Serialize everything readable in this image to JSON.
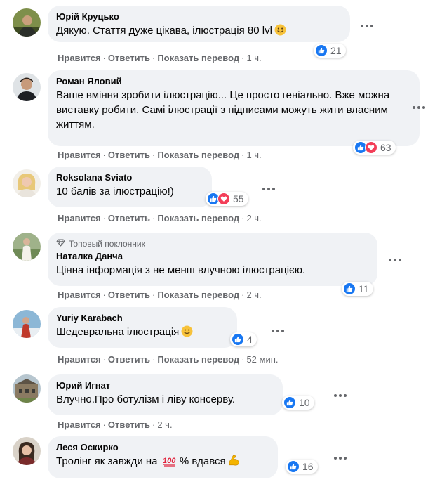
{
  "comments": [
    {
      "author": "Юрій Круцько",
      "text": "Дякую. Стаття дуже цікава, ілюстрація 80 lvl",
      "emoji": "slightly-smiling-face",
      "reactions": {
        "icons": [
          "like"
        ],
        "count": "21"
      },
      "actions": {
        "like": "Нравится",
        "reply": "Ответить",
        "translate": "Показать перевод",
        "time": "1 ч."
      }
    },
    {
      "author": "Роман Яловий",
      "text": "Ваше вміння зробити ілюстрацію... Це просто геніально. Вже можна виставку робити. Самі ілюстрації з підписами можуть жити власним життям.",
      "reactions": {
        "icons": [
          "like",
          "love"
        ],
        "count": "63"
      },
      "actions": {
        "like": "Нравится",
        "reply": "Ответить",
        "translate": "Показать перевод",
        "time": "1 ч."
      }
    },
    {
      "author": "Roksolana Sviato",
      "text": "10 балів за ілюстрацію!)",
      "reactions": {
        "icons": [
          "like",
          "love"
        ],
        "count": "55"
      },
      "actions": {
        "like": "Нравится",
        "reply": "Ответить",
        "translate": "Показать перевод",
        "time": "2 ч."
      }
    },
    {
      "badge": "Топовый поклонник",
      "author": "Наталка Данча",
      "text": "Цінна інформація з не менш влучною ілюстрацією.",
      "reactions": {
        "icons": [
          "like"
        ],
        "count": "11"
      },
      "actions": {
        "like": "Нравится",
        "reply": "Ответить",
        "translate": "Показать перевод",
        "time": "2 ч."
      }
    },
    {
      "author": "Yuriy Karabach",
      "text": "Шедевральна ілюстрація",
      "emoji": "slightly-smiling-face",
      "reactions": {
        "icons": [
          "like"
        ],
        "count": "4"
      },
      "actions": {
        "like": "Нравится",
        "reply": "Ответить",
        "translate": "Показать перевод",
        "time": "52 мин."
      }
    },
    {
      "author": "Юрий Игнат",
      "text": "Влучно.Про ботулізм і ліву консерву.",
      "reactions": {
        "icons": [
          "like"
        ],
        "count": "10"
      },
      "actions": {
        "like": "Нравится",
        "reply": "Ответить",
        "translate": "Показать перевод",
        "time": "2 ч."
      }
    },
    {
      "author": "Леся Оскирко",
      "text_before": "Тролінг як завжди на",
      "text_after": "% вдався",
      "inline_emoji_1": "100-points",
      "inline_emoji_2": "flexed-biceps",
      "reactions": {
        "icons": [
          "like"
        ],
        "count": "16"
      },
      "actions": {}
    }
  ],
  "colors": {
    "bubble_bg": "#f0f2f5",
    "like_blue": "#1877f2",
    "love_red": "#f33e58",
    "meta_gray": "#65676b",
    "text": "#050505"
  }
}
